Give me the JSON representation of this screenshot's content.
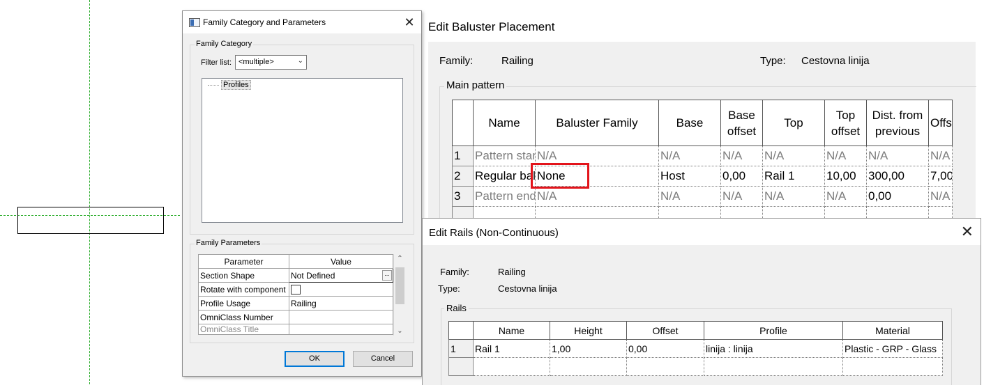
{
  "canvas": {
    "guide_color": "#2fae2f"
  },
  "family_dialog": {
    "title": "Family Category and Parameters",
    "close_glyph": "✕",
    "category_group_label": "Family Category",
    "filter_label": "Filter list:",
    "filter_value": "<multiple>",
    "categories": [
      "Profiles"
    ],
    "parameters_group_label": "Family Parameters",
    "param_headers": {
      "parameter": "Parameter",
      "value": "Value"
    },
    "params": [
      {
        "name": "Section Shape",
        "value": "Not Defined",
        "has_browse": true
      },
      {
        "name": "Rotate with component",
        "value": "",
        "checkbox": true,
        "checked": false
      },
      {
        "name": "Profile Usage",
        "value": "Railing"
      },
      {
        "name": "OmniClass Number",
        "value": ""
      },
      {
        "name": "OmniClass Title",
        "value": ""
      }
    ],
    "browse_glyph": "...",
    "ok_label": "OK",
    "cancel_label": "Cancel"
  },
  "baluster": {
    "title": "Edit Baluster Placement",
    "family_label": "Family:",
    "family_value": "Railing",
    "type_label": "Type:",
    "type_value": "Cestovna linija",
    "main_pattern_label": "Main pattern",
    "headers": [
      "",
      "Name",
      "Baluster Family",
      "Base",
      "Base offset",
      "Top",
      "Top offset",
      "Dist. from previous",
      "Offset"
    ],
    "rows": [
      {
        "num": "1",
        "name": "Pattern start",
        "family": "N/A",
        "base": "N/A",
        "base_offset": "N/A",
        "top": "N/A",
        "top_offset": "N/A",
        "dist": "N/A",
        "offset": "N/A",
        "disabled": true
      },
      {
        "num": "2",
        "name": "Regular baluster",
        "family": "None",
        "base": "Host",
        "base_offset": "0,00",
        "top": "Rail 1",
        "top_offset": "10,00",
        "dist": "300,00",
        "offset": "7,00",
        "disabled": false
      },
      {
        "num": "3",
        "name": "Pattern end",
        "family": "N/A",
        "base": "N/A",
        "base_offset": "N/A",
        "top": "N/A",
        "top_offset": "N/A",
        "dist": "0,00",
        "offset": "N/A",
        "disabled": true
      }
    ],
    "highlight_color": "#e3141b"
  },
  "rails_dialog": {
    "title": "Edit Rails (Non-Continuous)",
    "close_glyph": "✕",
    "family_label": "Family:",
    "family_value": "Railing",
    "type_label": "Type:",
    "type_value": "Cestovna linija",
    "rails_group_label": "Rails",
    "headers": [
      "",
      "Name",
      "Height",
      "Offset",
      "Profile",
      "Material"
    ],
    "rows": [
      {
        "num": "1",
        "name": "Rail 1",
        "height": "1,00",
        "offset": "0,00",
        "profile": "linija : linija",
        "material": "Plastic - GRP - Glass"
      }
    ]
  }
}
